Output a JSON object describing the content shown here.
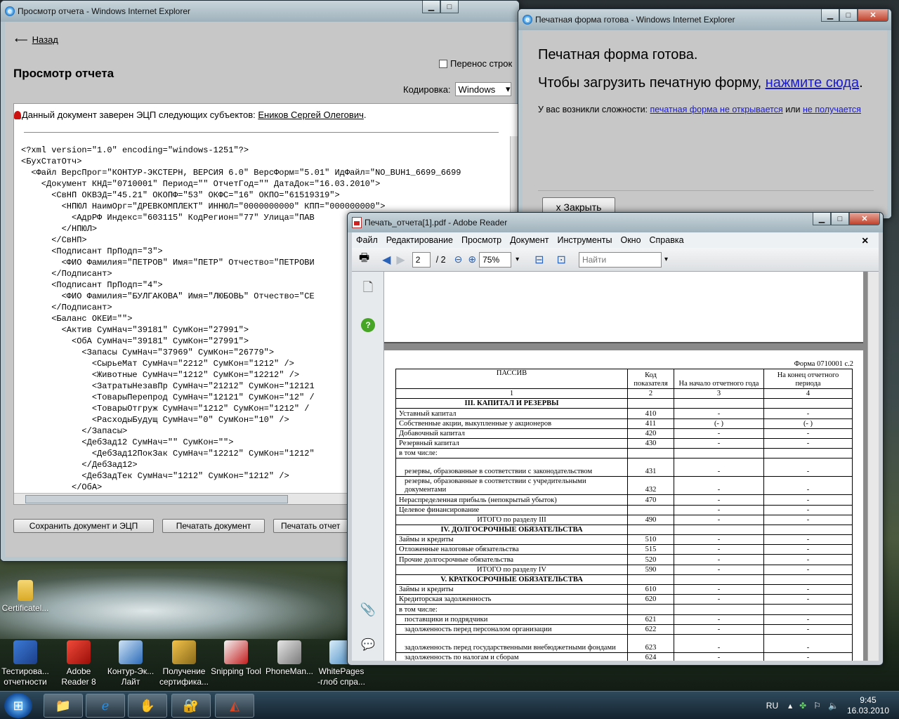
{
  "window1": {
    "title": "Просмотр отчета - Windows Internet Explorer",
    "back_label": "Назад",
    "heading": "Просмотр отчета",
    "wrap_label": "Перенос строк",
    "encoding_label": "Кодировка:",
    "encoding_value": "Windows",
    "signature_text": "Данный документ заверен ЭЦП следующих субъектов:",
    "signature_name": "Еников Сергей Олегович",
    "xml_lines": [
      "<?xml version=\"1.0\" encoding=\"windows-1251\"?>",
      "<БухСтатОтч>",
      "  <Файл ВерсПрог=\"КОНТУР-ЭКСТЕРН, ВЕРСИЯ 6.0\" ВерсФорм=\"5.01\" ИдФайл=\"NO_BUH1_6699_6699",
      "    <Документ КНД=\"0710001\" Период=\"\" ОтчетГод=\"\" ДатаДок=\"16.03.2010\">",
      "      <СвНП ОКВЭД=\"45.21\" ОКОПФ=\"53\" ОКФС=\"16\" ОКПО=\"61519319\">",
      "        <НПЮЛ НаимОрг=\"ДРЕВКОМПЛЕКТ\" ИННЮЛ=\"0000000000\" КПП=\"000000000\">",
      "          <АдрРФ Индекс=\"603115\" КодРегион=\"77\" Улица=\"ПАВ",
      "        </НПЮЛ>",
      "      </СвНП>",
      "      <Подписант ПрПодп=\"3\">",
      "        <ФИО Фамилия=\"ПЕТРОВ\" Имя=\"ПЕТР\" Отчество=\"ПЕТРОВИ",
      "      </Подписант>",
      "      <Подписант ПрПодп=\"4\">",
      "        <ФИО Фамилия=\"БУЛГАКОВА\" Имя=\"ЛЮБОВЬ\" Отчество=\"СЕ",
      "      </Подписант>",
      "      <Баланс ОКЕИ=\"\">",
      "        <Актив СумНач=\"39181\" СумКон=\"27991\">",
      "          <ОбА СумНач=\"39181\" СумКон=\"27991\">",
      "            <Запасы СумНач=\"37969\" СумКон=\"26779\">",
      "              <СырьеМат СумНач=\"2212\" СумКон=\"1212\" />",
      "              <Животные СумНач=\"1212\" СумКон=\"12212\" />",
      "              <ЗатратыНезавПр СумНач=\"21212\" СумКон=\"12121",
      "              <ТоварыПерепрод СумНач=\"12121\" СумКон=\"12\" /",
      "              <ТоварыОтгруж СумНач=\"1212\" СумКон=\"1212\" /",
      "              <РасходыБудущ СумНач=\"0\" СумКон=\"10\" />",
      "            </Запасы>",
      "            <ДебЗад12 СумНач=\"\" СумКон=\"\">",
      "              <ДебЗад12ПокЗак СумНач=\"12212\" СумКон=\"1212\"",
      "            </ДебЗад12>",
      "            <ДебЗадТек СумНач=\"1212\" СумКон=\"1212\" />",
      "          </ОбА>"
    ],
    "btn_save": "Сохранить документ и ЭЦП",
    "btn_print_doc": "Печатать документ",
    "btn_print_report": "Печатать отчет"
  },
  "window2": {
    "title": "Печатная форма готова - Windows Internet Explorer",
    "heading": "Печатная форма готова.",
    "line_prefix": "Чтобы загрузить печатную форму,",
    "line_link": "нажмите сюда",
    "line_suffix": ".",
    "trouble_prefix": "У вас возникли сложности:",
    "trouble_link1": "печатная форма не открывается",
    "trouble_mid": "или",
    "trouble_link2": "не получается",
    "close_btn": "x Закрыть"
  },
  "window3": {
    "title": "Печать_отчета[1].pdf - Adobe Reader",
    "menu": [
      "Файл",
      "Редактирование",
      "Просмотр",
      "Документ",
      "Инструменты",
      "Окно",
      "Справка"
    ],
    "page_current": "2",
    "page_total": "/ 2",
    "zoom": "75%",
    "find_placeholder": "Найти",
    "form_label": "Форма 0710001 с.2",
    "table_header": {
      "col1": "ПАССИВ",
      "col2": "Код показателя",
      "col3": "На начало отчетного года",
      "col4": "На конец отчетного периода"
    },
    "table_numrow": [
      "1",
      "2",
      "3",
      "4"
    ],
    "rows": [
      {
        "name": "III. КАПИТАЛ И РЕЗЕРВЫ",
        "code": "",
        "start": "",
        "end": "",
        "type": "section"
      },
      {
        "name": "Уставный капитал",
        "code": "410",
        "start": "-",
        "end": "-"
      },
      {
        "name": "Собственные акции, выкупленные у акционеров",
        "code": "411",
        "start": "(- )",
        "end": "(- )"
      },
      {
        "name": "Добавочный капитал",
        "code": "420",
        "start": "-",
        "end": "-"
      },
      {
        "name": "Резервный капитал",
        "code": "430",
        "start": "-",
        "end": "-"
      },
      {
        "name": "  в том числе:",
        "code": "",
        "start": "",
        "end": ""
      },
      {
        "name": "резервы, образованные в соответствии с законодательством",
        "code": "431",
        "start": "-",
        "end": "-"
      },
      {
        "name": "резервы, образованные в соответствии с учредительными документами",
        "code": "432",
        "start": "-",
        "end": "-"
      },
      {
        "name": "Нераспределенная прибыль (непокрытый убыток)",
        "code": "470",
        "start": "-",
        "end": "-"
      },
      {
        "name": "Целевое финансирование",
        "code": "",
        "start": "-",
        "end": "-"
      },
      {
        "name": "ИТОГО по разделу III",
        "code": "490",
        "start": "-",
        "end": "-",
        "type": "total"
      },
      {
        "name": "IV. ДОЛГОСРОЧНЫЕ ОБЯЗАТЕЛЬСТВА",
        "code": "",
        "start": "",
        "end": "",
        "type": "section"
      },
      {
        "name": "Займы и кредиты",
        "code": "510",
        "start": "-",
        "end": "-"
      },
      {
        "name": "Отложенные налоговые обязательства",
        "code": "515",
        "start": "-",
        "end": "-"
      },
      {
        "name": "Прочие долгосрочные обязательства",
        "code": "520",
        "start": "-",
        "end": "-"
      },
      {
        "name": "ИТОГО по разделу IV",
        "code": "590",
        "start": "-",
        "end": "-",
        "type": "total"
      },
      {
        "name": "V. КРАТКОСРОЧНЫЕ ОБЯЗАТЕЛЬСТВА",
        "code": "",
        "start": "",
        "end": "",
        "type": "section"
      },
      {
        "name": "Займы и кредиты",
        "code": "610",
        "start": "-",
        "end": "-"
      },
      {
        "name": "Кредиторская задолженность",
        "code": "620",
        "start": "-",
        "end": "-"
      },
      {
        "name": "  в том числе:",
        "code": "",
        "start": "",
        "end": ""
      },
      {
        "name": "поставщики и подрядчики",
        "code": "621",
        "start": "-",
        "end": "-"
      },
      {
        "name": "задолженность перед персоналом организации",
        "code": "622",
        "start": "-",
        "end": "-"
      },
      {
        "name": "задолженность перед государственными внебюджетными фондами",
        "code": "623",
        "start": "-",
        "end": "-"
      },
      {
        "name": "задолженность по налогам и сборам",
        "code": "624",
        "start": "-",
        "end": "-"
      }
    ]
  },
  "desktop_icons": [
    {
      "label": "Certificatel...",
      "icon": "folder-icon"
    },
    {
      "label": "Тестирова... отчетности",
      "icon": "test-icon"
    },
    {
      "label": "Adobe Reader 8",
      "icon": "adobe-icon"
    },
    {
      "label": "Контур-Эк... Лайт",
      "icon": "kontur-icon"
    },
    {
      "label": "Получение сертифика...",
      "icon": "cert-icon"
    },
    {
      "label": "Snipping Tool",
      "icon": "scissors-icon"
    },
    {
      "label": "PhoneMan...",
      "icon": "phone-icon"
    },
    {
      "label": "WhitePages -глоб спра...",
      "icon": "book-icon"
    }
  ],
  "taskbar": {
    "lang": "RU",
    "time": "9:45",
    "date": "16.03.2010"
  }
}
